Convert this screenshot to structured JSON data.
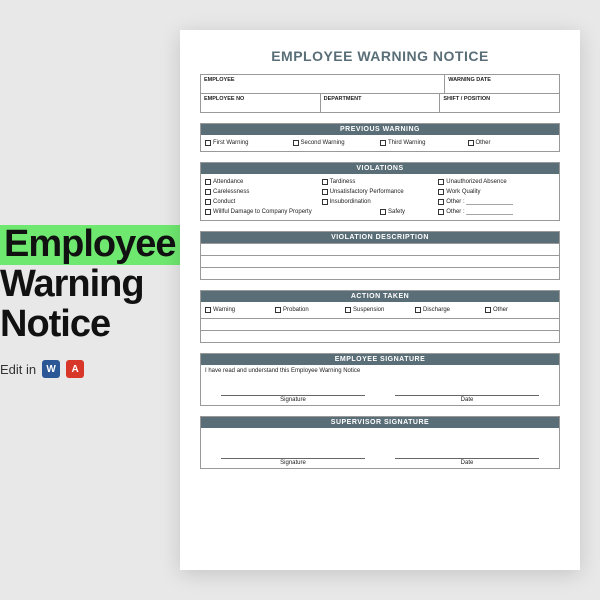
{
  "promo": {
    "line1": "Employee",
    "line2": "Warning",
    "line3": "Notice",
    "edit_label": "Edit in"
  },
  "doc": {
    "title": "EMPLOYEE WARNING NOTICE",
    "fields": {
      "employee": "EMPLOYEE",
      "warning_date": "WARNING DATE",
      "employee_no": "EMPLOYEE NO",
      "department": "DEPARTMENT",
      "shift_position": "SHIFT / POSITION"
    },
    "sections": {
      "previous_warning": {
        "title": "PREVIOUS WARNING",
        "options": [
          "First Warning",
          "Second Warning",
          "Third Warning",
          "Other"
        ]
      },
      "violations": {
        "title": "VIOLATIONS",
        "options": [
          "Attendance",
          "Tardiness",
          "Unauthorized Absence",
          "Carelessness",
          "Unsatisfactory Performance",
          "Work Quality",
          "Conduct",
          "Insubordination",
          "Other : ______________",
          "Willful Damage to Company Property",
          "Safety",
          "Other : ______________"
        ]
      },
      "violation_description": {
        "title": "VIOLATION DESCRIPTION"
      },
      "action_taken": {
        "title": "ACTION TAKEN",
        "options": [
          "Warning",
          "Probation",
          "Suspension",
          "Discharge",
          "Other"
        ]
      },
      "employee_signature": {
        "title": "EMPLOYEE SIGNATURE",
        "ack": "I have read and understand this Employee Warning Notice",
        "sig": "Signature",
        "date": "Date"
      },
      "supervisor_signature": {
        "title": "SUPERVISOR SIGNATURE",
        "sig": "Signature",
        "date": "Date"
      }
    }
  }
}
